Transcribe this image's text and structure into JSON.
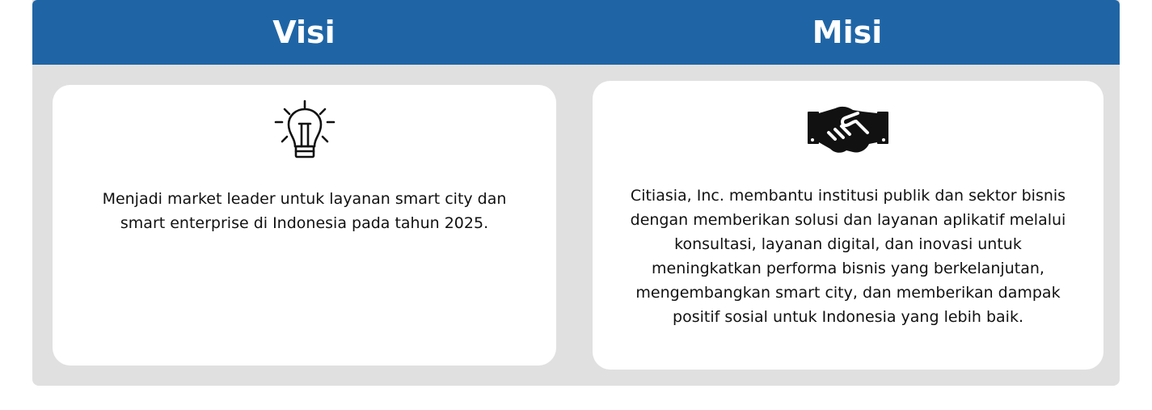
{
  "visi": {
    "title": "Visi",
    "icon": "lightbulb-icon",
    "text": "Menjadi market leader untuk layanan smart city dan smart enterprise di Indonesia pada tahun 2025."
  },
  "misi": {
    "title": "Misi",
    "icon": "handshake-icon",
    "text": "Citiasia, Inc. membantu institusi publik dan sektor bisnis dengan memberikan solusi dan layanan aplikatif melalui konsultasi, layanan digital, dan inovasi untuk meningkatkan performa bisnis yang berkelanjutan, mengembangkan smart city, dan memberikan dampak positif sosial untuk Indonesia yang lebih baik."
  },
  "colors": {
    "header": "#1f65a6",
    "panel": "#e0e0e0",
    "card": "#ffffff"
  }
}
